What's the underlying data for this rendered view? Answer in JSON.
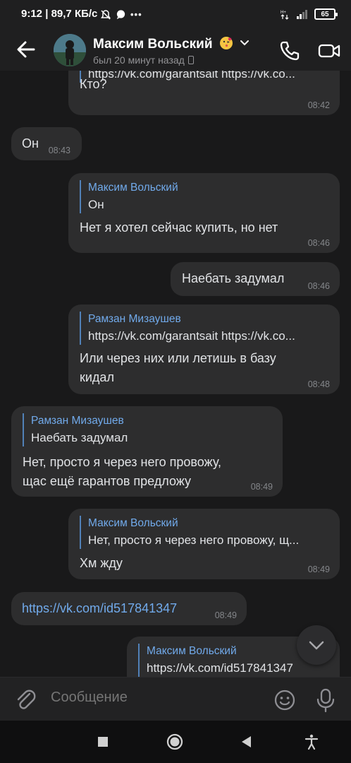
{
  "status_bar": {
    "time": "9:12",
    "speed": "89,7 КБ/с",
    "battery": "65"
  },
  "header": {
    "name": "Максим Вольский",
    "last_seen": "был 20 минут назад"
  },
  "messages": [
    {
      "side": "out",
      "quote_text": "https://vk.com/garantsait https://vk.co...",
      "text": "Кто?",
      "time": "08:42"
    },
    {
      "side": "in",
      "text": "Он",
      "time": "08:43"
    },
    {
      "side": "out",
      "quote_name": "Максим Вольский",
      "quote_text": "Он",
      "text": "Нет я хотел сейчас купить, но нет",
      "time": "08:46"
    },
    {
      "side": "out",
      "text": "Наебать задумал",
      "time": "08:46"
    },
    {
      "side": "out",
      "quote_name": "Рамзан Мизаушев",
      "quote_text": "https://vk.com/garantsait https://vk.co...",
      "text_line1": "Или через них или летишь в базу",
      "text_line2": "кидал",
      "time": "08:48"
    },
    {
      "side": "in",
      "quote_name": "Рамзан Мизаушев",
      "quote_text": "Наебать задумал",
      "text_line1": "Нет, просто я через него провожу,",
      "text_line2": "щас ещё гарантов предложу",
      "time": "08:49"
    },
    {
      "side": "out",
      "quote_name": "Максим Вольский",
      "quote_text": "Нет, просто я через него провожу, щ...",
      "text": "Хм жду",
      "time": "08:49"
    },
    {
      "side": "in",
      "text": "https://vk.com/id517841347",
      "time": "08:49"
    },
    {
      "side": "out",
      "quote_name": "Максим Вольский",
      "quote_text": "https://vk.com/id517841347"
    }
  ],
  "composer": {
    "placeholder": "Сообщение"
  },
  "colors": {
    "background": "#19191a",
    "bubble": "#2d2d2e",
    "accent": "#71aaeb",
    "quote_bar": "#5181b8"
  }
}
